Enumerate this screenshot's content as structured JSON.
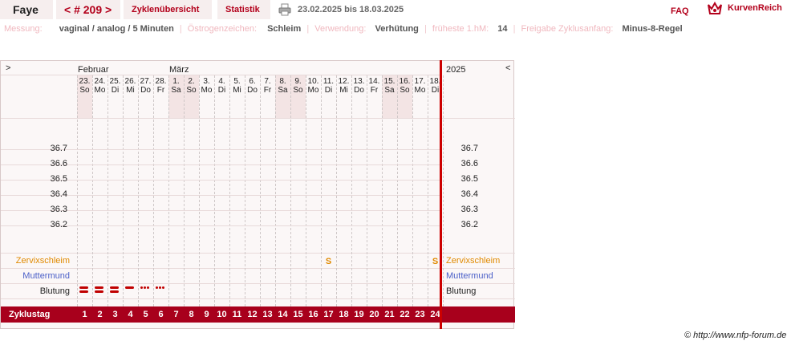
{
  "header": {
    "name": "Faye",
    "cycle": "< # 209 >",
    "tab_overview": "Zyklenübersicht",
    "tab_stats": "Statistik",
    "date_range": "23.02.2025 bis 18.03.2025",
    "faq": "FAQ",
    "logo": "KurvenReich"
  },
  "info": {
    "messung_label": "Messung:",
    "messung_value": "vaginal / analog / 5 Minuten",
    "oestrogen_label": "Östrogenzeichen:",
    "oestrogen_value": "Schleim",
    "verwendung_label": "Verwendung:",
    "verwendung_value": "Verhütung",
    "hm_label": "früheste 1.hM:",
    "hm_value": "14",
    "freigabe_label": "Freigabe Zyklusanfang:",
    "freigabe_value": "Minus-8-Regel"
  },
  "chart": {
    "nav_left": ">",
    "nav_right": "<",
    "year": "2025",
    "month_feb": "Februar",
    "month_mar": "März",
    "days": [
      {
        "d": "23.",
        "w": "So",
        "we": true
      },
      {
        "d": "24.",
        "w": "Mo",
        "we": false
      },
      {
        "d": "25.",
        "w": "Di",
        "we": false
      },
      {
        "d": "26.",
        "w": "Mi",
        "we": false
      },
      {
        "d": "27.",
        "w": "Do",
        "we": false
      },
      {
        "d": "28.",
        "w": "Fr",
        "we": false
      },
      {
        "d": "1.",
        "w": "Sa",
        "we": true
      },
      {
        "d": "2.",
        "w": "So",
        "we": true
      },
      {
        "d": "3.",
        "w": "Mo",
        "we": false
      },
      {
        "d": "4.",
        "w": "Di",
        "we": false
      },
      {
        "d": "5.",
        "w": "Mi",
        "we": false
      },
      {
        "d": "6.",
        "w": "Do",
        "we": false
      },
      {
        "d": "7.",
        "w": "Fr",
        "we": false
      },
      {
        "d": "8.",
        "w": "Sa",
        "we": true
      },
      {
        "d": "9.",
        "w": "So",
        "we": true
      },
      {
        "d": "10.",
        "w": "Mo",
        "we": false
      },
      {
        "d": "11.",
        "w": "Di",
        "we": false
      },
      {
        "d": "12.",
        "w": "Mi",
        "we": false
      },
      {
        "d": "13.",
        "w": "Do",
        "we": false
      },
      {
        "d": "14.",
        "w": "Fr",
        "we": false
      },
      {
        "d": "15.",
        "w": "Sa",
        "we": true
      },
      {
        "d": "16.",
        "w": "So",
        "we": true
      },
      {
        "d": "17.",
        "w": "Mo",
        "we": false
      },
      {
        "d": "18.",
        "w": "Di",
        "we": false
      }
    ],
    "temps": [
      "36.7",
      "36.6",
      "36.5",
      "36.4",
      "36.3",
      "36.2"
    ],
    "row_zervix": "Zervixschleim",
    "row_mumu": "Muttermund",
    "row_blutung": "Blutung",
    "row_zyklustag": "Zyklustag",
    "zervix_marks": [
      {
        "day": 17,
        "mark": "S"
      },
      {
        "day": 24,
        "mark": "S"
      }
    ],
    "bleeding": [
      "heavy",
      "heavy",
      "heavy",
      "medium",
      "spotting",
      "spotting"
    ],
    "cycle_days": [
      "1",
      "2",
      "3",
      "4",
      "5",
      "6",
      "7",
      "8",
      "9",
      "10",
      "11",
      "12",
      "13",
      "14",
      "15",
      "16",
      "17",
      "18",
      "19",
      "20",
      "21",
      "22",
      "23",
      "24"
    ],
    "colors": {
      "accent": "#a8001c",
      "zervix": "#e08a00",
      "mumu": "#4a5fc8",
      "bleeding": "#c00000"
    }
  },
  "footer": {
    "copyright": "© http://www.nfp-forum.de"
  }
}
